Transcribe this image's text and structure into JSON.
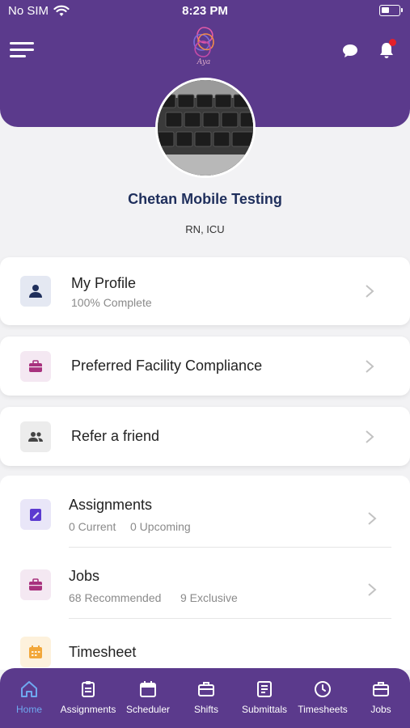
{
  "status_bar": {
    "carrier": "No SIM",
    "time": "8:23 PM"
  },
  "header": {
    "logo_text": "Aya"
  },
  "profile": {
    "name": "Chetan Mobile Testing",
    "role": "RN, ICU"
  },
  "cards": [
    {
      "title": "My Profile",
      "subtitle": "100% Complete",
      "icon": "person-icon"
    },
    {
      "title": "Preferred Facility Compliance",
      "icon": "briefcase-icon"
    },
    {
      "title": "Refer a friend",
      "icon": "people-icon"
    }
  ],
  "list": [
    {
      "title": "Assignments",
      "current": "0 Current",
      "upcoming": "0 Upcoming",
      "icon": "clipboard-icon"
    },
    {
      "title": "Jobs",
      "recommended": "68 Recommended",
      "exclusive": "9 Exclusive",
      "icon": "briefcase-icon"
    },
    {
      "title": "Timesheet",
      "icon": "calendar-icon"
    }
  ],
  "tabs": [
    {
      "label": "Home",
      "icon": "home-icon",
      "active": true
    },
    {
      "label": "Assignments",
      "icon": "clipboard-icon"
    },
    {
      "label": "Scheduler",
      "icon": "calendar-icon"
    },
    {
      "label": "Shifts",
      "icon": "briefcase-icon"
    },
    {
      "label": "Submittals",
      "icon": "document-icon"
    },
    {
      "label": "Timesheets",
      "icon": "clock-icon"
    },
    {
      "label": "Jobs",
      "icon": "briefcase-icon"
    }
  ],
  "colors": {
    "brand": "#5b3a8c",
    "active_tab": "#6fa8f0",
    "notification": "#e5202a",
    "name": "#1f2f5c"
  }
}
